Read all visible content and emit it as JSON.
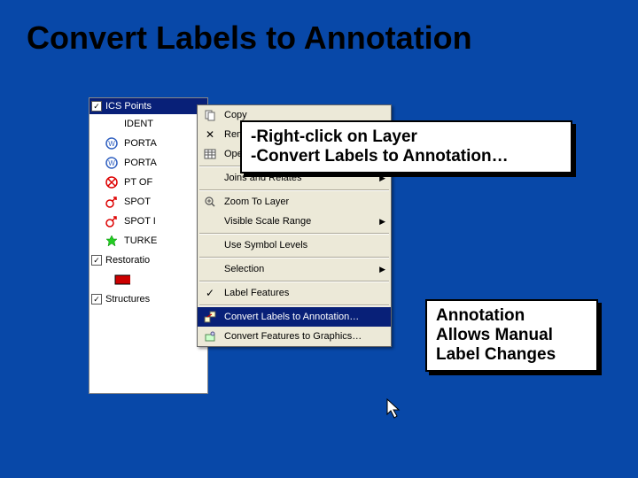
{
  "slide": {
    "title": "Convert Labels to Annotation"
  },
  "toc": {
    "items": [
      {
        "label": "ICS Points",
        "checked": true,
        "icon": "none",
        "top": true
      },
      {
        "label": "IDENT",
        "icon": "none"
      },
      {
        "label": "PORTA",
        "icon": "circle-w"
      },
      {
        "label": "PORTA",
        "icon": "circle-w"
      },
      {
        "label": "PT OF",
        "icon": "circle-x"
      },
      {
        "label": "SPOT",
        "icon": "mars-red"
      },
      {
        "label": "SPOT I",
        "icon": "mars-red"
      },
      {
        "label": "TURKE",
        "icon": "star-green"
      },
      {
        "label": "Restoratio",
        "checked": true,
        "icon": "rect-red"
      },
      {
        "label": "Structures",
        "checked": true,
        "icon": "none"
      }
    ]
  },
  "ctx": {
    "items": [
      {
        "label": "Copy",
        "icon": "copy-icon"
      },
      {
        "label": "Remove",
        "icon": "x-icon"
      },
      {
        "label": "Open Attribute Table",
        "icon": "table-icon"
      },
      {
        "label": "Joins and Relates",
        "submenu": true,
        "sep_before": true
      },
      {
        "label": "Zoom To Layer",
        "icon": "zoom-icon",
        "sep_before": true
      },
      {
        "label": "Visible Scale Range",
        "submenu": true
      },
      {
        "label": "Use Symbol Levels",
        "sep_before": true
      },
      {
        "label": "Selection",
        "submenu": true,
        "sep_before": true
      },
      {
        "label": "Label Features",
        "icon": "check-icon",
        "sep_before": true
      },
      {
        "label": "Convert Labels to Annotation…",
        "icon": "convert-icon",
        "sep_before": true,
        "selected": true
      },
      {
        "label": "Convert Features to Graphics…",
        "icon": "features-icon"
      }
    ]
  },
  "callout1": {
    "line1": "-Right-click on Layer",
    "line2": "-Convert Labels to Annotation…"
  },
  "callout2": {
    "line1": "Annotation",
    "line2": "Allows Manual",
    "line3": "Label Changes"
  }
}
